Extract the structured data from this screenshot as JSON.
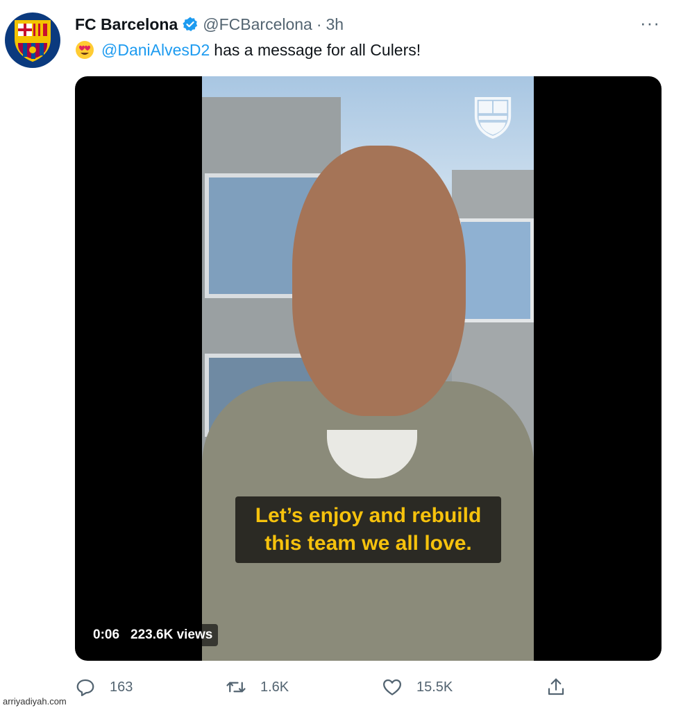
{
  "account": {
    "name": "FC Barcelona",
    "handle": "@FCBarcelona",
    "separator": "·",
    "time": "3h",
    "avatar_icon": "fcb-crest-icon",
    "verified_icon": "verified-badge-icon",
    "more_label": "···"
  },
  "tweet": {
    "emoji_icon": "heart-eyes-emoji-icon",
    "mention": "@DaniAlvesD2",
    "text": "has a message for all Culers!"
  },
  "video": {
    "caption_line1": "Let’s enjoy and rebuild",
    "caption_line2": "this team we all love.",
    "time": "0:06",
    "views": "223.6K views",
    "watermark_icon": "fcb-crest-icon"
  },
  "actions": {
    "replies": "163",
    "retweets": "1.6K",
    "likes": "15.5K"
  },
  "footer": {
    "site_watermark": "arriyadiyah.com"
  },
  "colors": {
    "link": "#1d9bf0",
    "muted": "#536471",
    "caption_text": "#f6c20d"
  }
}
